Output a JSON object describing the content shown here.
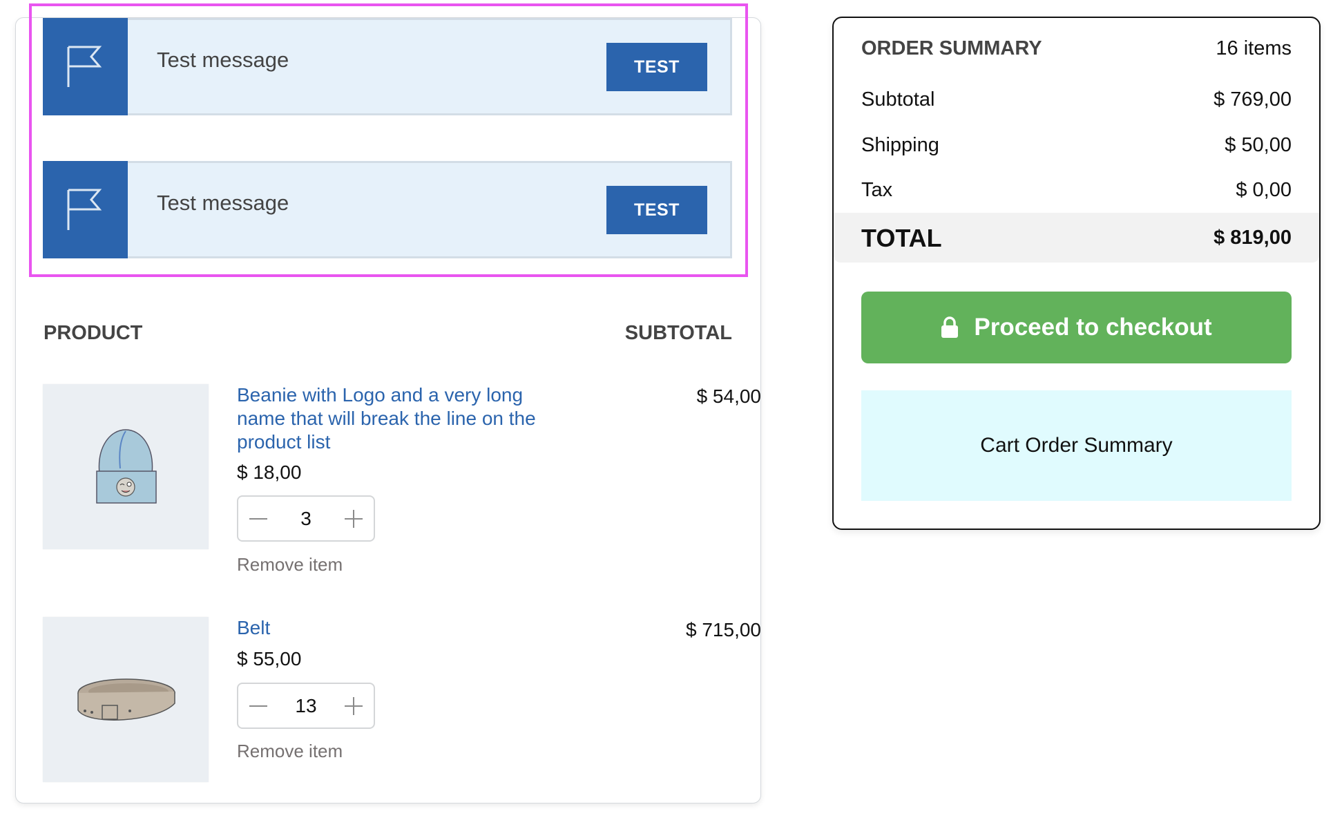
{
  "notices": [
    {
      "icon": "flag-icon",
      "message": "Test message",
      "button_label": "TEST"
    },
    {
      "icon": "flag-icon",
      "message": "Test message",
      "button_label": "TEST"
    }
  ],
  "cart": {
    "columns": {
      "product": "PRODUCT",
      "subtotal": "SUBTOTAL"
    },
    "items": [
      {
        "name": "Beanie with Logo and a very long name that will break the line on the product list",
        "price": "$ 18,00",
        "quantity": "3",
        "remove_label": "Remove item",
        "subtotal": "$ 54,00",
        "image": "beanie-image"
      },
      {
        "name": "Belt",
        "price": "$ 55,00",
        "quantity": "13",
        "remove_label": "Remove item",
        "subtotal": "$ 715,00",
        "image": "belt-image"
      }
    ]
  },
  "summary": {
    "title": "ORDER SUMMARY",
    "item_count": "16 items",
    "rows": [
      {
        "label": "Subtotal",
        "value": "$ 769,00"
      },
      {
        "label": "Shipping",
        "value": "$ 50,00"
      },
      {
        "label": "Tax",
        "value": "$ 0,00"
      }
    ],
    "total_label": "TOTAL",
    "total_value": "$ 819,00",
    "checkout_label": "Proceed to checkout",
    "placeholder_block": "Cart Order Summary"
  },
  "colors": {
    "accent_blue": "#2b64ad",
    "checkout_green": "#62b25b",
    "highlight_magenta": "#e955f0",
    "notice_bg": "#e6f1fa",
    "placeholder_bg": "#e0fbfe"
  }
}
